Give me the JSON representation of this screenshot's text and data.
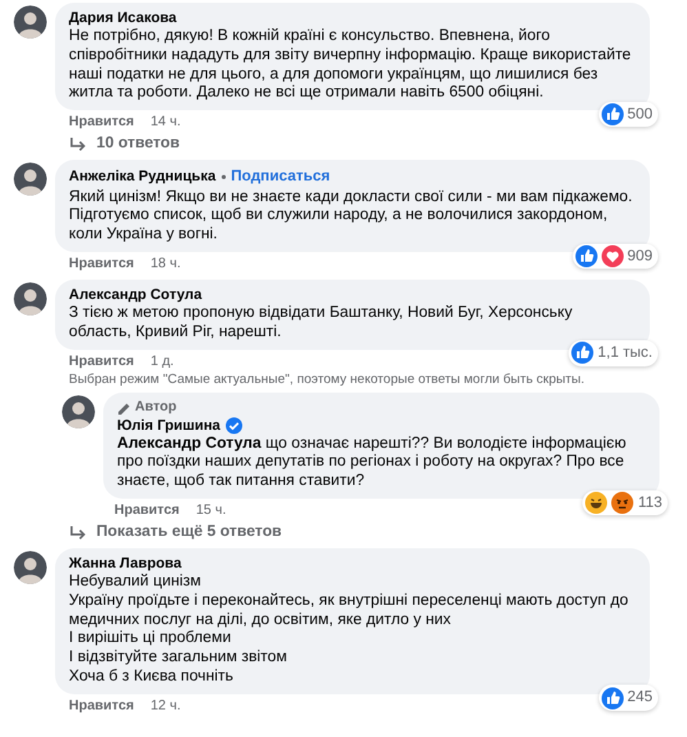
{
  "comments": [
    {
      "author": "Дария Исакова",
      "paragraphs": [
        "Не потрібно, дякую! В кожній країні є консульство. Впевнена, його співробітники нададуть для звіту вичерпну інформацію. Краще використайте наші податки не для цього, а для допомоги українцям, що лишилися без житла та роботи. Далеко не всі ще отримали навіть 6500 обіцяні."
      ],
      "reactions": [
        {
          "kind": "like"
        }
      ],
      "reaction_count": "500",
      "like_label": "Нравится",
      "time": "14 ч.",
      "replies_link": "10 ответов"
    },
    {
      "author": "Анжеліка Рудницька",
      "follow": "Подписаться",
      "paragraphs": [
        "Який цинізм! Якщо ви не знаєте кади докласти свої сили - ми вам підкажемо. Підготуємо список, щоб ви служили народу, а не волочилися закордоном, коли Україна у вогні."
      ],
      "reactions": [
        {
          "kind": "like"
        },
        {
          "kind": "love"
        }
      ],
      "reaction_count": "909",
      "like_label": "Нравится",
      "time": "18 ч."
    },
    {
      "author": "Александр Сотула",
      "paragraphs": [
        "З тією ж метою пропоную відвідати Баштанку, Новий Буг, Херсонську область, Кривий Ріг, нарешті."
      ],
      "reactions": [
        {
          "kind": "like"
        }
      ],
      "reaction_count": "1,1 тыс.",
      "like_label": "Нравится",
      "time": "1 д.",
      "notice": "Выбран режим \"Самые актуальные\", поэтому некоторые ответы могли быть скрыты.",
      "replies": [
        {
          "role": "Автор",
          "author": "Юлія Гришина",
          "verified": true,
          "paragraphs": [
            "**Александр Сотула** що означає нарешті?? Ви володієте інформацією про поїздки наших депутатів по регіонах і роботу на округах? Про все знаєте, щоб так питання ставити?"
          ],
          "reactions": [
            {
              "kind": "haha"
            },
            {
              "kind": "angry"
            }
          ],
          "reaction_count": "113",
          "like_label": "Нравится",
          "time": "15 ч."
        }
      ],
      "replies_link": "Показать ещё 5 ответов"
    },
    {
      "author": "Жанна Лаврова",
      "paragraphs": [
        "Небувалий цинізм",
        "Україну проїдьте і переконайтесь, як внутрішні переселенці мають доступ до медичних послуг на ділі, до освітим, яке дитло у них",
        "І вирішіть ці проблеми",
        "І відзвітуйте загальним звітом",
        "Хоча б з Києва почніть"
      ],
      "reactions": [
        {
          "kind": "like"
        }
      ],
      "reaction_count": "245",
      "like_label": "Нравится",
      "time": "12 ч."
    }
  ]
}
